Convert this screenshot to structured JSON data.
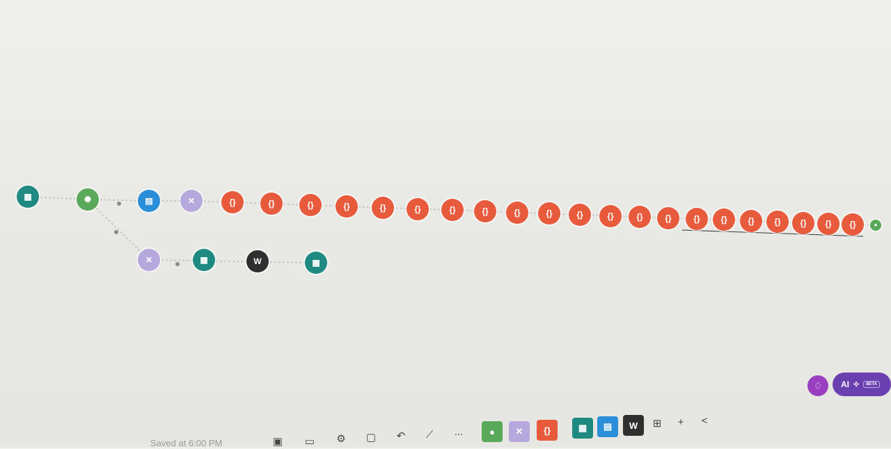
{
  "scenario": {
    "saved_text": "Saved at 6:00 PM"
  },
  "colors": {
    "red": "#e85a3c",
    "green": "#5aa85a",
    "teal": "#1e8a82",
    "blue": "#2a8fd8",
    "lavender": "#b6a8dc",
    "dark": "#2f2f2f",
    "purple": "#6a3fb0"
  },
  "nodes": {
    "google_sheets_trigger": {
      "icon": "google-sheets-icon"
    },
    "router": {
      "icon": "router-icon"
    },
    "google_docs_top": {
      "icon": "google-docs-icon"
    },
    "tools_top": {
      "icon": "tools-icon"
    },
    "openai_modules": {
      "icon": "openai-icon",
      "count": 21
    },
    "end_module": {
      "icon": "flow-end-icon"
    },
    "tools_bottom": {
      "icon": "tools-icon"
    },
    "google_sheets_bottom": {
      "icon": "google-sheets-icon"
    },
    "wordpress": {
      "icon": "wordpress-icon"
    },
    "google_sheets_final": {
      "icon": "google-sheets-icon"
    }
  },
  "toolbar": {
    "save_icon": "save-icon",
    "scheduling_icon": "scheduling-icon",
    "settings_icon": "settings-icon",
    "notes_icon": "notes-icon",
    "undo_icon": "undo-icon",
    "magic_icon": "magic-wand-icon",
    "more_label": "...",
    "apps": [
      "flow-control",
      "tools",
      "openai",
      "google-sheets",
      "google-docs",
      "wordpress"
    ],
    "grid_icon": "grid-icon",
    "add_label": "+",
    "collapse_label": "<"
  },
  "ai": {
    "label": "AI",
    "badge": "BETA",
    "hint_icon": "lightbulb-icon"
  }
}
